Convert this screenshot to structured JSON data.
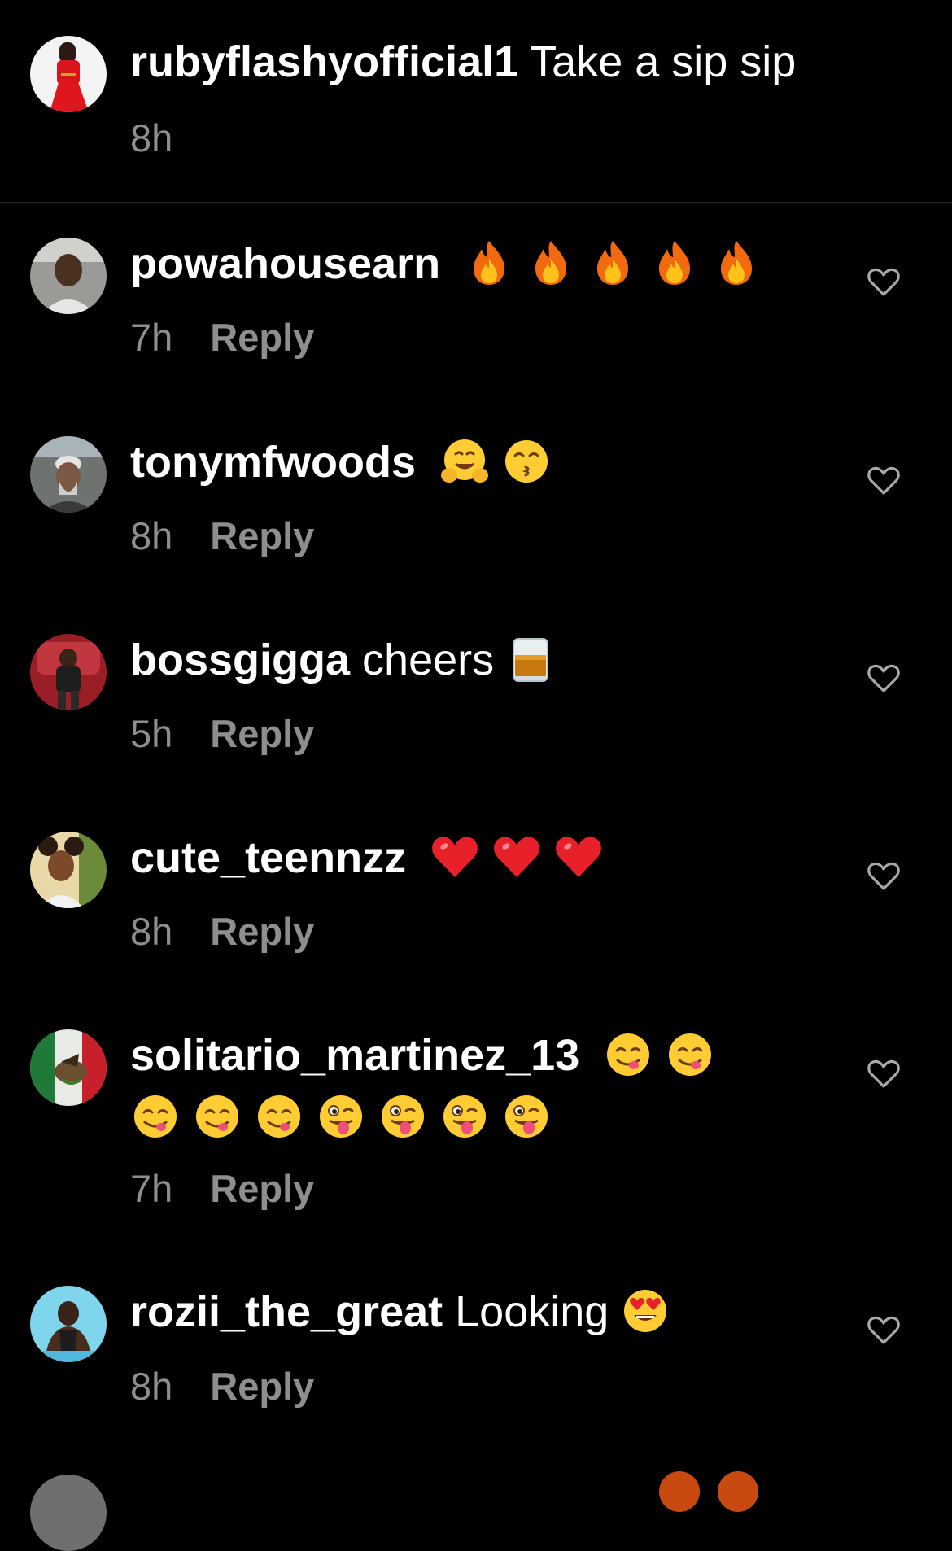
{
  "caption": {
    "username": "rubyflashyofficial1",
    "text": "Take a sip sip",
    "time": "8h"
  },
  "reply_label": "Reply",
  "comments": [
    {
      "username": "powahousearn",
      "text": "",
      "emojis": [
        "fire",
        "fire",
        "fire",
        "fire",
        "fire"
      ],
      "time": "7h"
    },
    {
      "username": "tonymfwoods",
      "text": "",
      "emojis": [
        "hugging-face",
        "kissing-face"
      ],
      "time": "8h"
    },
    {
      "username": "bossgigga",
      "text": "cheers",
      "emojis": [
        "tumbler-glass"
      ],
      "time": "5h"
    },
    {
      "username": "cute_teennzz",
      "text": "",
      "emojis": [
        "red-heart",
        "red-heart",
        "red-heart"
      ],
      "time": "8h"
    },
    {
      "username": "solitario_martinez_13",
      "text": "",
      "emojis": [
        "yum-face",
        "yum-face",
        "yum-face",
        "yum-face",
        "yum-face",
        "winking-tongue-face",
        "winking-tongue-face",
        "winking-tongue-face",
        "winking-tongue-face"
      ],
      "time": "7h"
    },
    {
      "username": "rozii_the_great",
      "text": "Looking",
      "emojis": [
        "heart-eyes-face"
      ],
      "time": "8h"
    }
  ],
  "colors": {
    "background": "#000000",
    "text": "#ffffff",
    "muted": "#8e8e8e",
    "divider": "#262626",
    "like_outline": "#a8a8a8"
  }
}
